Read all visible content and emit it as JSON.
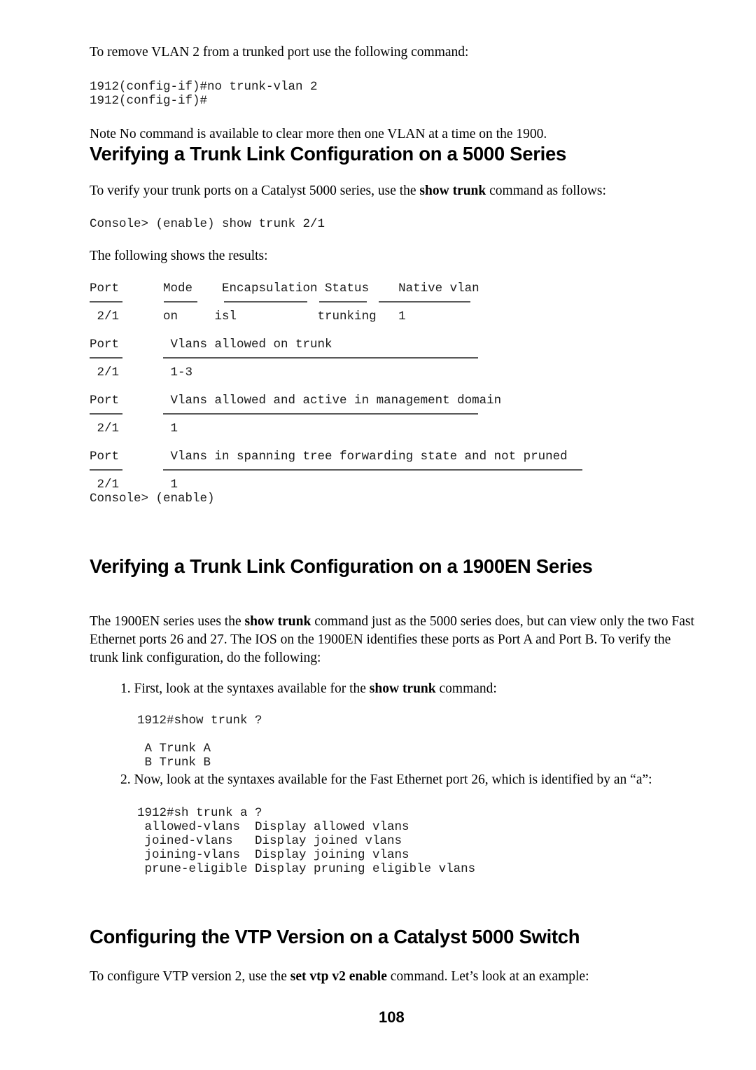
{
  "document": {
    "page_number": "108",
    "intro_paragraph": "To remove VLAN 2 from a trunked port use the following command:",
    "intro_code": "1912(config-if)#no trunk-vlan 2\n1912(config-if)#",
    "note": {
      "label": "Note",
      "text": "No command is available to clear more then one VLAN at a time on the 1900."
    },
    "sections": [
      {
        "heading": "Verifying a Trunk Link Configuration on a 5000 Series",
        "paragraph_pre": "To verify your trunk ports on a Catalyst 5000 series, use the ",
        "paragraph_bold": "show trunk",
        "paragraph_post": " command as follows:",
        "command": "Console> (enable) show trunk 2/1",
        "results_lead": "The following shows the results:",
        "terminal": {
          "table1": {
            "headers": "Port      Mode    Encapsulation Status    Native vlan",
            "row": " 2/1      on     isl           trunking   1"
          },
          "table2": {
            "headers": "Port       Vlans allowed on trunk",
            "row": " 2/1       1-3"
          },
          "table3": {
            "headers": "Port       Vlans allowed and active in management domain",
            "row": " 2/1       1"
          },
          "table4": {
            "headers": "Port       Vlans in spanning tree forwarding state and not pruned",
            "row": " 2/1       1"
          },
          "prompt_end": "Console> (enable)"
        }
      },
      {
        "heading": "Verifying a Trunk Link Configuration on a 1900EN Series",
        "paragraph_pre": "The 1900EN series uses the ",
        "paragraph_bold": "show trunk",
        "paragraph_post": " command just as the 5000 series does, but can view only the two Fast Ethernet ports 26 and 27. The IOS on the 1900EN identifies these ports as Port A and Port B. To verify the trunk link configuration, do the following:",
        "steps": [
          {
            "number": "1.",
            "text_pre": "First, look at the syntaxes available for the ",
            "text_bold": "show trunk",
            "text_post": " command:",
            "code": "1912#show trunk ?\n\n A Trunk A\n B Trunk B"
          },
          {
            "number": "2.",
            "text_pre": "Now, look at the syntaxes available for the Fast Ethernet port 26, which is identified by an “a”:",
            "text_bold": "",
            "text_post": "",
            "code": "1912#sh trunk a ?\n allowed-vlans  Display allowed vlans\n joined-vlans   Display joined vlans\n joining-vlans  Display joining vlans\n prune-eligible Display pruning eligible vlans"
          }
        ]
      },
      {
        "heading": "Configuring the VTP Version on a Catalyst 5000 Switch",
        "paragraph_pre": "To configure VTP version 2, use the ",
        "paragraph_bold": "set vtp v2 enable",
        "paragraph_post": " command. Let’s look at an example:"
      }
    ]
  }
}
